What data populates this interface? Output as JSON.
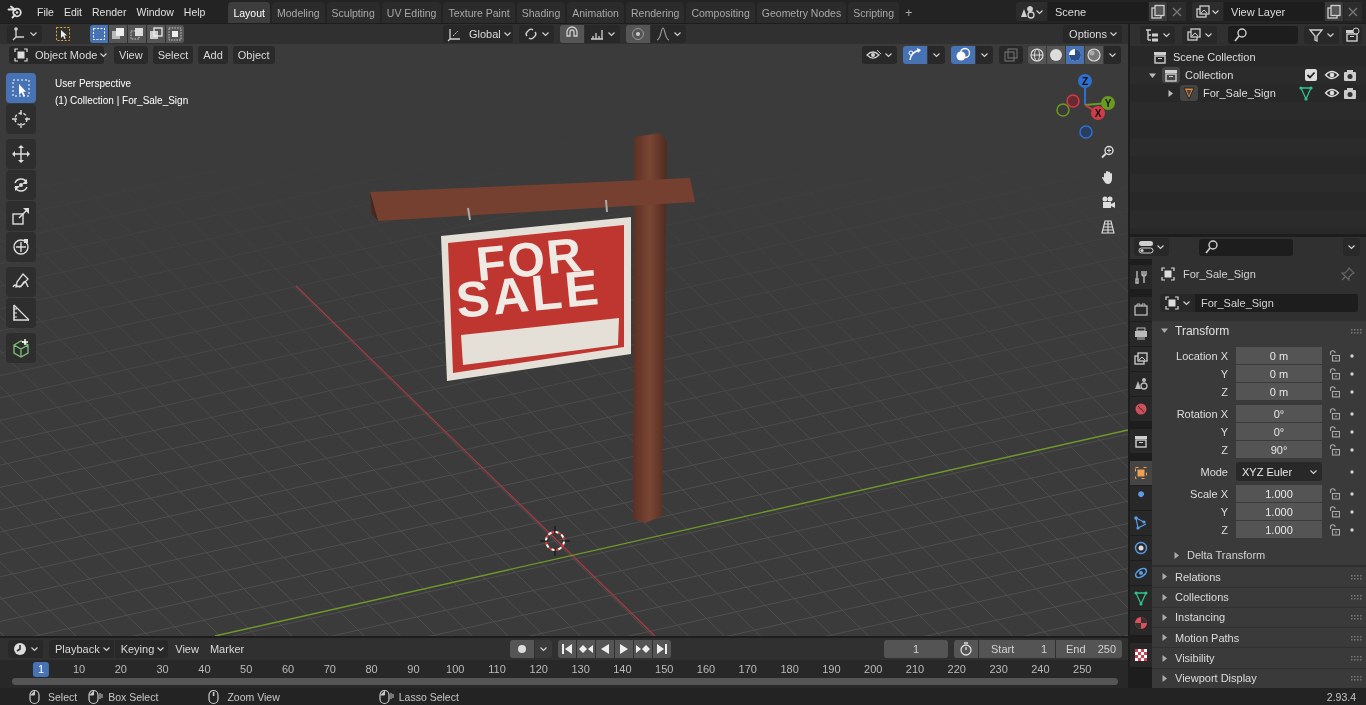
{
  "top_bar": {
    "menus": [
      "File",
      "Edit",
      "Render",
      "Window",
      "Help"
    ],
    "workspaces": [
      {
        "label": "Layout",
        "selected": true
      },
      {
        "label": "Modeling",
        "selected": false
      },
      {
        "label": "Sculpting",
        "selected": false
      },
      {
        "label": "UV Editing",
        "selected": false
      },
      {
        "label": "Texture Paint",
        "selected": false
      },
      {
        "label": "Shading",
        "selected": false
      },
      {
        "label": "Animation",
        "selected": false
      },
      {
        "label": "Rendering",
        "selected": false
      },
      {
        "label": "Compositing",
        "selected": false
      },
      {
        "label": "Geometry Nodes",
        "selected": false
      },
      {
        "label": "Scripting",
        "selected": false
      }
    ],
    "add_workspace": "+",
    "scene": "Scene",
    "view_layer": "View Layer"
  },
  "viewport": {
    "orientation": "Global",
    "options": "Options",
    "mode": "Object Mode",
    "menus": [
      "View",
      "Select",
      "Add",
      "Object"
    ],
    "select_modes": [
      {
        "selected": true
      },
      {
        "selected": false
      },
      {
        "selected": false
      },
      {
        "selected": false
      },
      {
        "selected": false
      }
    ],
    "show_gizmos": true,
    "show_overlays": true,
    "shading_modes": [
      {
        "selected": false
      },
      {
        "selected": false
      },
      {
        "selected": true
      },
      {
        "selected": false
      }
    ],
    "tools": [
      {
        "selected": true
      },
      {
        "selected": false
      },
      {
        "selected": false
      },
      {
        "selected": false
      },
      {
        "selected": false
      },
      {
        "selected": false
      },
      {
        "selected": false
      },
      {
        "selected": false
      },
      {
        "selected": false
      }
    ],
    "overlay_lines": [
      "User Perspective",
      "(1) Collection | For_Sale_Sign"
    ],
    "gizmo_axes": [
      "Z",
      "Y",
      "X"
    ],
    "sign_text": [
      "FOR",
      "SALE"
    ]
  },
  "outliner": {
    "tree": [
      {
        "label": "Scene Collection",
        "kind": "scene_collection",
        "children": [
          {
            "label": "Collection",
            "kind": "collection",
            "expanded": true,
            "checked": true,
            "children": [
              {
                "label": "For_Sale_Sign",
                "kind": "object",
                "expanded": false
              }
            ]
          }
        ]
      }
    ]
  },
  "properties": {
    "tabs": [
      {
        "selected": false
      },
      {
        "selected": false
      },
      {
        "selected": false
      },
      {
        "selected": false
      },
      {
        "selected": false
      },
      {
        "selected": false
      },
      {
        "selected": false
      },
      {
        "selected": true
      },
      {
        "selected": false
      },
      {
        "selected": false
      },
      {
        "selected": false
      },
      {
        "selected": false
      },
      {
        "selected": false
      },
      {
        "selected": false
      },
      {
        "selected": false
      }
    ],
    "object_name": "For_Sale_Sign",
    "datablock": "For_Sale_Sign",
    "transform": {
      "title": "Transform",
      "expanded": true,
      "groups": [
        {
          "kind": "fields",
          "rows": [
            {
              "label": "Location X",
              "value": "0 m"
            },
            {
              "label": "Y",
              "value": "0 m"
            },
            {
              "label": "Z",
              "value": "0 m"
            }
          ]
        },
        {
          "kind": "fields",
          "rows": [
            {
              "label": "Rotation X",
              "value": "0°"
            },
            {
              "label": "Y",
              "value": "0°"
            },
            {
              "label": "Z",
              "value": "90°"
            }
          ]
        },
        {
          "kind": "dropdown",
          "label": "Mode",
          "value": "XYZ Euler"
        },
        {
          "kind": "fields",
          "rows": [
            {
              "label": "Scale X",
              "value": "1.000"
            },
            {
              "label": "Y",
              "value": "1.000"
            },
            {
              "label": "Z",
              "value": "1.000"
            }
          ]
        }
      ],
      "subpanels": [
        {
          "title": "Delta Transform",
          "expanded": false
        }
      ]
    },
    "panels": [
      {
        "title": "Relations",
        "expanded": false
      },
      {
        "title": "Collections",
        "expanded": false
      },
      {
        "title": "Instancing",
        "expanded": false
      },
      {
        "title": "Motion Paths",
        "expanded": false
      },
      {
        "title": "Visibility",
        "expanded": false
      },
      {
        "title": "Viewport Display",
        "expanded": false
      }
    ]
  },
  "timeline": {
    "menus": [
      {
        "label": "Playback",
        "dropdown": true
      },
      {
        "label": "Keying",
        "dropdown": true
      },
      {
        "label": "View",
        "dropdown": false
      },
      {
        "label": "Marker",
        "dropdown": false
      }
    ],
    "auto_keying": false,
    "current_frame": "1",
    "start_label": "Start",
    "start": "1",
    "end_label": "End",
    "end": "250",
    "ruler": [
      {
        "label": "1",
        "selected": true
      },
      {
        "label": "10",
        "selected": false
      },
      {
        "label": "20",
        "selected": false
      },
      {
        "label": "30",
        "selected": false
      },
      {
        "label": "40",
        "selected": false
      },
      {
        "label": "50",
        "selected": false
      },
      {
        "label": "60",
        "selected": false
      },
      {
        "label": "70",
        "selected": false
      },
      {
        "label": "80",
        "selected": false
      },
      {
        "label": "90",
        "selected": false
      },
      {
        "label": "100",
        "selected": false
      },
      {
        "label": "110",
        "selected": false
      },
      {
        "label": "120",
        "selected": false
      },
      {
        "label": "130",
        "selected": false
      },
      {
        "label": "140",
        "selected": false
      },
      {
        "label": "150",
        "selected": false
      },
      {
        "label": "160",
        "selected": false
      },
      {
        "label": "170",
        "selected": false
      },
      {
        "label": "180",
        "selected": false
      },
      {
        "label": "190",
        "selected": false
      },
      {
        "label": "200",
        "selected": false
      },
      {
        "label": "210",
        "selected": false
      },
      {
        "label": "220",
        "selected": false
      },
      {
        "label": "230",
        "selected": false
      },
      {
        "label": "240",
        "selected": false
      },
      {
        "label": "250",
        "selected": false
      }
    ]
  },
  "status_bar": {
    "hints": [
      "Select",
      "Box Select",
      "Zoom View",
      "Lasso Select"
    ],
    "version": "2.93.4"
  }
}
